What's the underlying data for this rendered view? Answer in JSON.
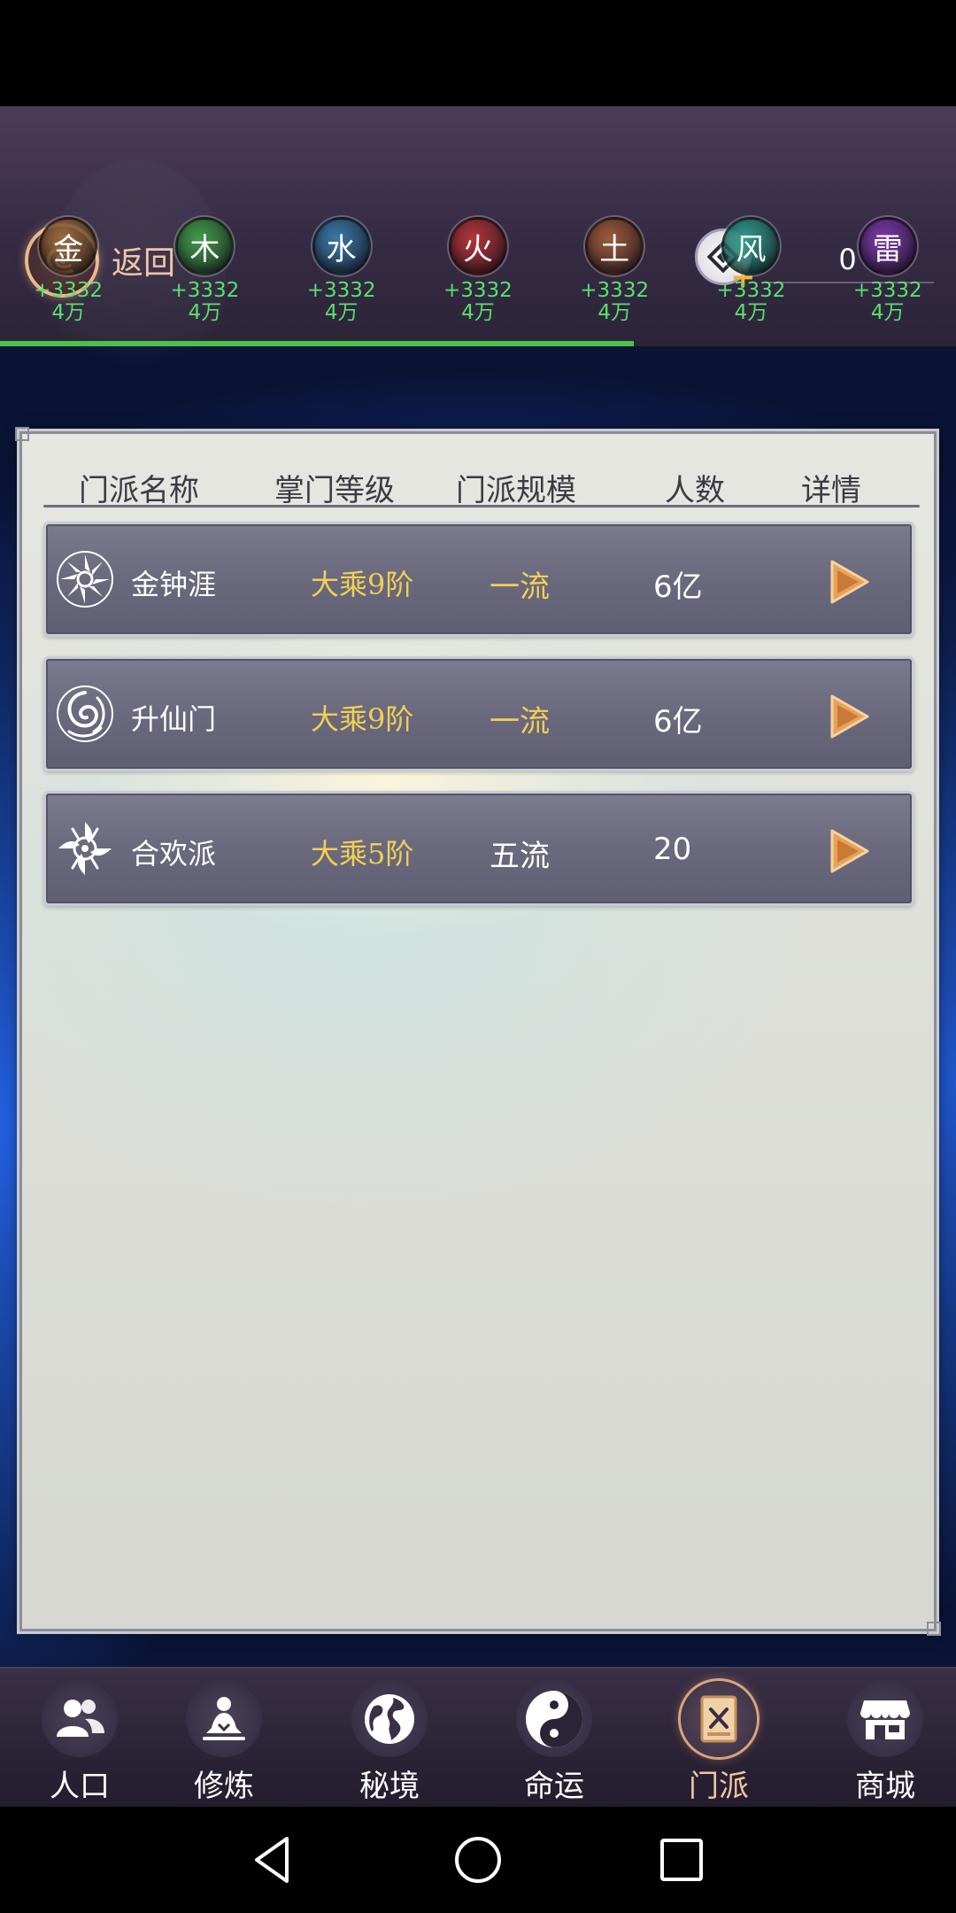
{
  "header": {
    "back_label": "返回",
    "currency_value": "0",
    "currency_plus": "+",
    "elements": [
      {
        "name": "金",
        "rate": "+3332",
        "amount": "4万",
        "color": "#9a6a3e"
      },
      {
        "name": "木",
        "rate": "+3332",
        "amount": "4万",
        "color": "#3f9b49"
      },
      {
        "name": "水",
        "rate": "+3332",
        "amount": "4万",
        "color": "#3a78a6"
      },
      {
        "name": "火",
        "rate": "+3332",
        "amount": "4万",
        "color": "#b2363a"
      },
      {
        "name": "土",
        "rate": "+3332",
        "amount": "4万",
        "color": "#9c5a3a"
      },
      {
        "name": "风",
        "rate": "+3332",
        "amount": "4万",
        "color": "#2f9c8e"
      },
      {
        "name": "雷",
        "rate": "+3332",
        "amount": "4万",
        "color": "#7a3aa8"
      }
    ],
    "progress_fraction": 0.663
  },
  "table": {
    "columns": [
      "门派名称",
      "掌门等级",
      "门派规模",
      "人数",
      "详情"
    ],
    "rows": [
      {
        "name": "金钟涯",
        "level": "大乘9阶",
        "scale": "一流",
        "count": "6亿",
        "scale_color": "#f2cf54"
      },
      {
        "name": "升仙门",
        "level": "大乘9阶",
        "scale": "一流",
        "count": "6亿",
        "scale_color": "#f2cf54"
      },
      {
        "name": "合欢派",
        "level": "大乘5阶",
        "scale": "五流",
        "count": "20",
        "scale_color": "#ffffff"
      }
    ]
  },
  "nav": {
    "items": [
      {
        "label": "人口",
        "icon": "population-icon"
      },
      {
        "label": "修炼",
        "icon": "meditation-icon"
      },
      {
        "label": "秘境",
        "icon": "globe-icon"
      },
      {
        "label": "命运",
        "icon": "yin-yang-icon"
      },
      {
        "label": "门派",
        "icon": "sect-scroll-icon",
        "active": true
      },
      {
        "label": "商城",
        "icon": "shop-icon"
      }
    ],
    "active_color": "#f2c6a4"
  }
}
